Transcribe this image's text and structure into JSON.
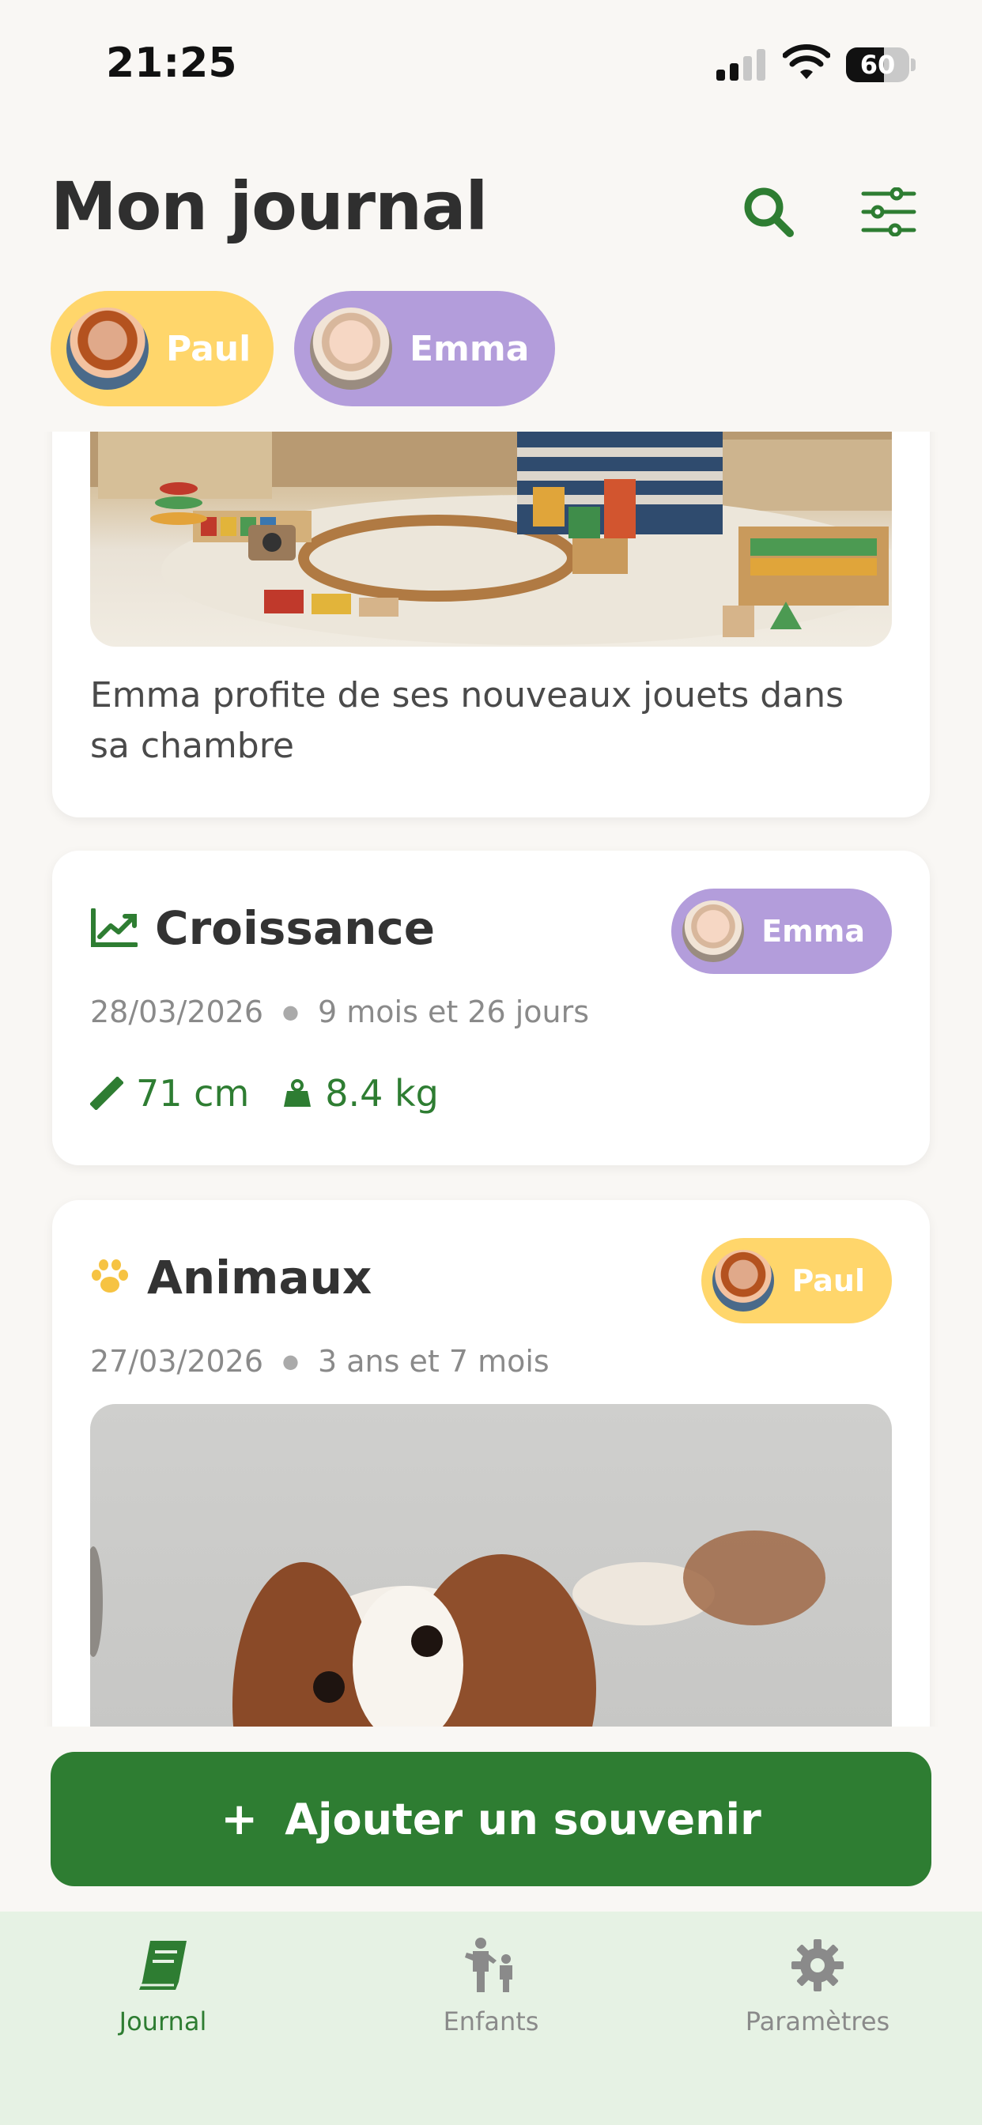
{
  "status_bar": {
    "time": "21:25",
    "battery": "60",
    "battery_level": 0.6
  },
  "header": {
    "title": "Mon journal"
  },
  "filters": {
    "children": [
      {
        "name": "Paul",
        "color": "#ffd66b"
      },
      {
        "name": "Emma",
        "color": "#b39ddb"
      }
    ]
  },
  "feed": {
    "cards": [
      {
        "caption": "Emma profite de ses nouveaux jouets dans sa chambre"
      },
      {
        "category": "Croissance",
        "icon": "growth-chart-icon",
        "date": "28/03/2026",
        "age": "9 mois et 26 jours",
        "child": "Emma",
        "height": "71 cm",
        "weight": "8.4 kg"
      },
      {
        "category": "Animaux",
        "icon": "paw-icon",
        "date": "27/03/2026",
        "age": "3 ans et 7 mois",
        "child": "Paul"
      }
    ]
  },
  "actions": {
    "add_plus": "+",
    "add_label": "Ajouter un souvenir"
  },
  "tabbar": {
    "items": [
      {
        "label": "Journal",
        "active": true
      },
      {
        "label": "Enfants",
        "active": false
      },
      {
        "label": "Paramètres",
        "active": false
      }
    ]
  },
  "colors": {
    "primary": "#2e7d32",
    "paul": "#ffd66b",
    "emma": "#b39ddb",
    "tabbar_bg": "#e6f2e4"
  }
}
